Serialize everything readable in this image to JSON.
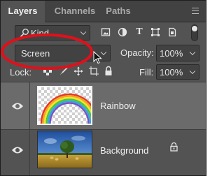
{
  "tabs": [
    {
      "label": "Layers"
    },
    {
      "label": "Channels"
    },
    {
      "label": "Paths"
    }
  ],
  "filter": {
    "kind_label": "Kind"
  },
  "blend": {
    "mode": "Screen",
    "opacity_label": "Opacity:",
    "opacity_value": "100%"
  },
  "lock": {
    "label": "Lock:",
    "fill_label": "Fill:",
    "fill_value": "100%"
  },
  "layers": [
    {
      "name": "Rainbow"
    },
    {
      "name": "Background"
    }
  ],
  "colors": {
    "panel": "#535353",
    "selected": "#6b6b6b",
    "annotation": "#e0101a"
  },
  "icons": [
    "search-icon",
    "filter-pixel-icon",
    "filter-adjustment-icon",
    "filter-type-icon",
    "filter-shape-icon",
    "filter-smart-object-icon",
    "filter-toggle-icon",
    "panel-menu-icon",
    "lock-transparent-icon",
    "lock-paint-icon",
    "lock-position-icon",
    "lock-artboard-icon",
    "lock-all-icon",
    "eye-icon",
    "lock-icon",
    "mouse-cursor-icon"
  ]
}
